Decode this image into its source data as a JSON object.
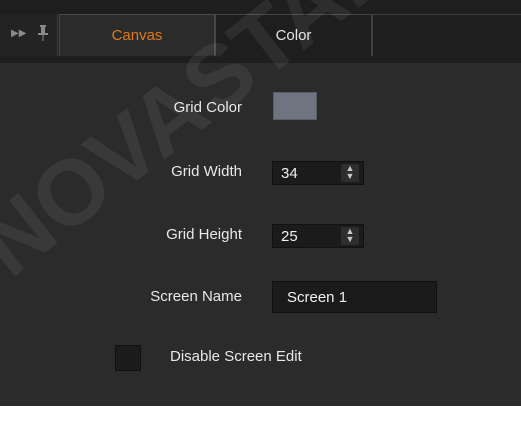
{
  "tabs": [
    {
      "label": "Canvas",
      "active": true
    },
    {
      "label": "Color",
      "active": false
    }
  ],
  "dock_icons": [
    "expand-arrows-icon",
    "pin-icon"
  ],
  "fields": {
    "grid_color": {
      "label": "Grid Color",
      "value": "#6f7480"
    },
    "grid_width": {
      "label": "Grid Width",
      "value": "34"
    },
    "grid_height": {
      "label": "Grid Height",
      "value": "25"
    },
    "screen_name": {
      "label": "Screen Name",
      "value": "Screen 1"
    },
    "disable_screen_edit": {
      "label": "Disable Screen Edit",
      "checked": false
    }
  },
  "colors": {
    "active_tab_text": "#e07a1f",
    "panel_bg": "#2b2b2b",
    "tab_bar_bg": "#1e1e1e"
  },
  "watermark": "NOVASTAR NOVA"
}
